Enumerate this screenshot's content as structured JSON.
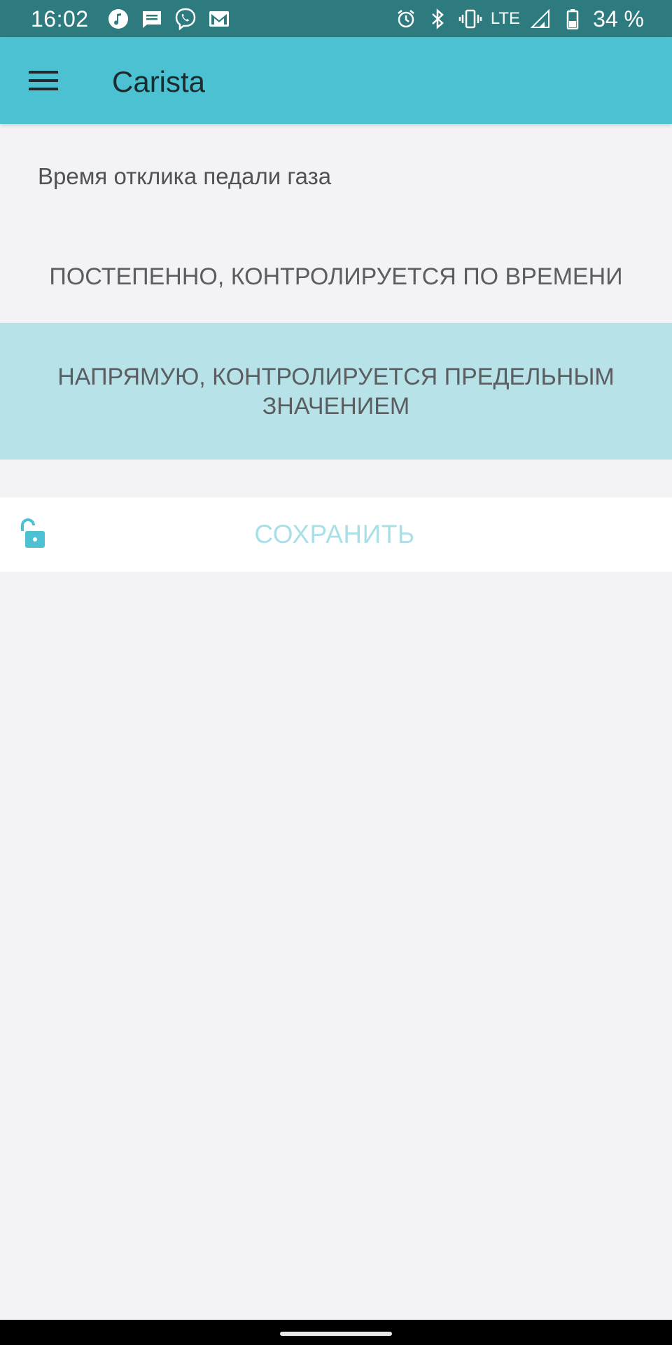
{
  "status_bar": {
    "time": "16:02",
    "left_icons": [
      "music-icon",
      "message-icon",
      "viber-icon",
      "gmail-icon"
    ],
    "right_icons": [
      "alarm-icon",
      "bluetooth-icon",
      "vibrate-icon",
      "signal-icon",
      "battery-icon"
    ],
    "network": "LTE",
    "battery": "34 %"
  },
  "app_bar": {
    "title": "Carista",
    "menu_icon": "hamburger-menu-icon",
    "background": "#4bc1d1"
  },
  "setting": {
    "title": "Время отклика педали газа",
    "options": [
      {
        "label": "ПОСТЕПЕННО, КОНТРОЛИРУЕТСЯ ПО ВРЕМЕНИ",
        "selected": false
      },
      {
        "label": "НАПРЯМУЮ, КОНТРОЛИРУЕТСЯ ПРЕДЕЛЬНЫМ ЗНАЧЕНИЕМ",
        "selected": true
      }
    ]
  },
  "save_bar": {
    "label": "СОХРАНИТЬ",
    "lock_icon": "unlocked-padlock-icon",
    "label_color": "#a9dfe7"
  },
  "colors": {
    "status_bar": "#2e7b7f",
    "accent": "#4bc1d1",
    "selected_option": "#b7e2e7",
    "background": "#f3f3f6"
  }
}
